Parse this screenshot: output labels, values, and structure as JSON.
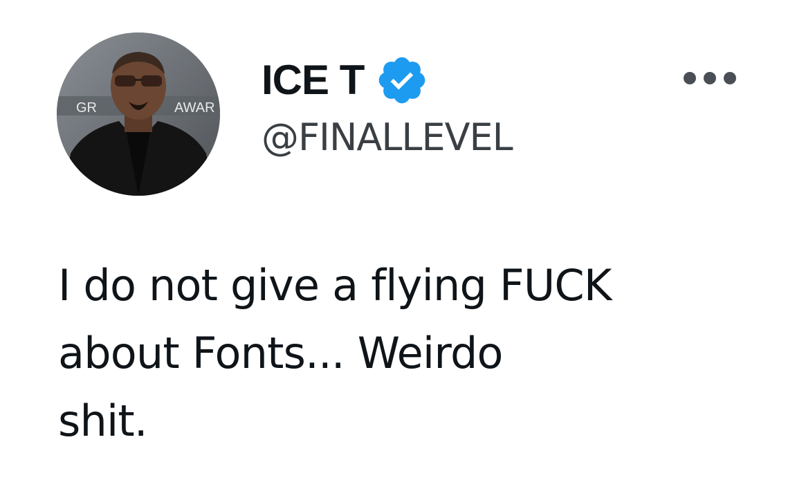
{
  "author": {
    "display_name": "ICE T",
    "handle": "@FINALLEVEL",
    "verified": true,
    "avatar_backdrop_text_left": "GR",
    "avatar_backdrop_text_right": "AWAR"
  },
  "tweet": {
    "text": "I do not give a flying FUCK\nabout Fonts... Weirdo\nshit."
  },
  "colors": {
    "verified_badge": "#1d9bf0",
    "text": "#0f1419",
    "handle": "#3a3f44"
  },
  "icons": {
    "more": "more-options-icon",
    "verified": "verified-badge-icon"
  }
}
